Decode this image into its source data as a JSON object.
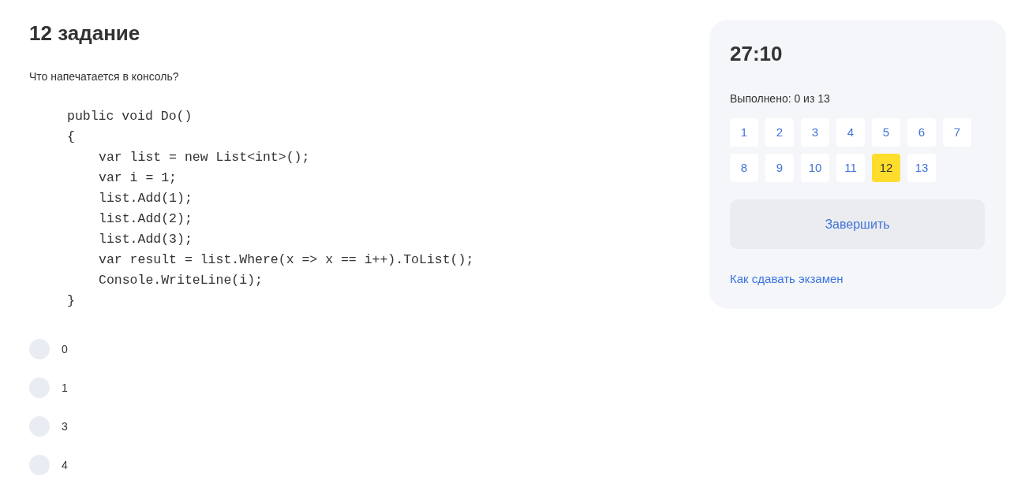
{
  "task": {
    "title": "12 задание",
    "question": "Что напечатается в консоль?",
    "code": [
      {
        "text": "public void Do()"
      },
      {
        "text": "{",
        "children": [
          {
            "text": "var list = new List<int>();"
          },
          {
            "text": "var i = 1;"
          },
          {
            "text": "list.Add(1);"
          },
          {
            "text": "list.Add(2);"
          },
          {
            "text": "list.Add(3);"
          },
          {
            "text": "var result = list.Where(x => x == i++).ToList();"
          },
          {
            "text": "Console.WriteLine(i);"
          }
        ]
      },
      {
        "text": "}"
      }
    ],
    "options": [
      {
        "label": "0",
        "selected": false
      },
      {
        "label": "1",
        "selected": false
      },
      {
        "label": "3",
        "selected": false
      },
      {
        "label": "4",
        "selected": false
      }
    ]
  },
  "sidebar": {
    "timer": "27:10",
    "progress": "Выполнено: 0 из 13",
    "questions": [
      {
        "label": "1",
        "selected": false
      },
      {
        "label": "2",
        "selected": false
      },
      {
        "label": "3",
        "selected": false
      },
      {
        "label": "4",
        "selected": false
      },
      {
        "label": "5",
        "selected": false
      },
      {
        "label": "6",
        "selected": false
      },
      {
        "label": "7",
        "selected": false
      },
      {
        "label": "8",
        "selected": false
      },
      {
        "label": "9",
        "selected": false
      },
      {
        "label": "10",
        "selected": false
      },
      {
        "label": "11",
        "selected": false
      },
      {
        "label": "12",
        "selected": true
      },
      {
        "label": "13",
        "selected": false
      }
    ],
    "finish_button": "Завершить",
    "help_link": "Как сдавать экзамен"
  }
}
